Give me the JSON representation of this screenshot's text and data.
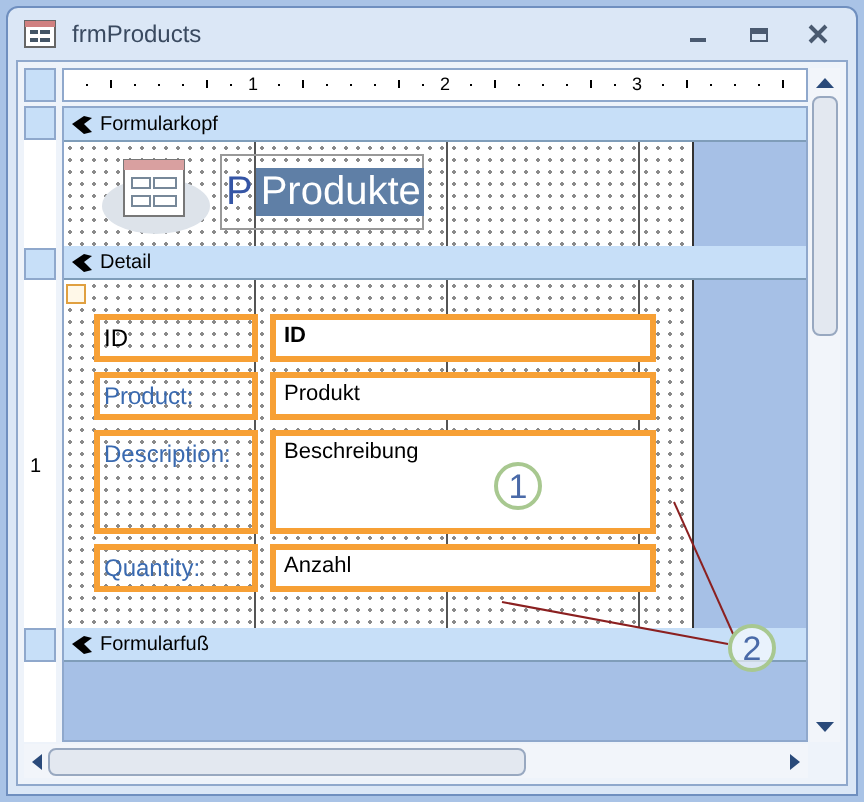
{
  "window": {
    "title": "frmProducts"
  },
  "ruler": {
    "labels": [
      "1",
      "2",
      "3"
    ],
    "vertical_labels": [
      "1"
    ]
  },
  "header": {
    "title": "Formularkopf",
    "label_hidden": "P",
    "label": "Produkte",
    "label_selected": true
  },
  "detail": {
    "title": "Detail",
    "fields": [
      {
        "label": "ID",
        "value": "ID",
        "value_bold": true,
        "selected": true,
        "kind": "single"
      },
      {
        "label": "Product:",
        "value": "Produkt",
        "value_bold": false,
        "selected": true,
        "kind": "single"
      },
      {
        "label": "Description:",
        "value": "Beschreibung",
        "value_bold": false,
        "selected": true,
        "kind": "multi"
      },
      {
        "label": "Quantity:",
        "value": "Anzahl",
        "value_bold": false,
        "selected": true,
        "kind": "single"
      }
    ]
  },
  "footer": {
    "title": "Formularfuß"
  },
  "callouts": [
    "1",
    "2"
  ]
}
